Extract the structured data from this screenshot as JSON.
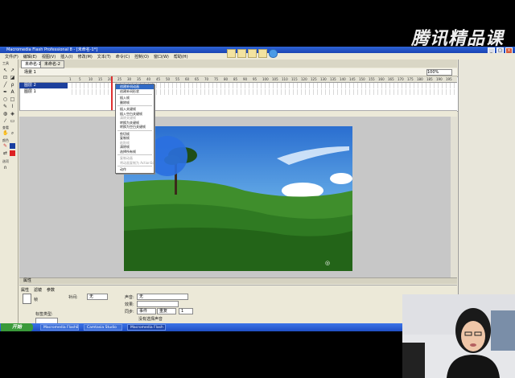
{
  "brand": {
    "logo_text": "腾讯精品课"
  },
  "window": {
    "title": "Macromedia Flash Professional 8 - [未命名-1*]"
  },
  "menu": [
    "文件(F)",
    "编辑(E)",
    "视图(V)",
    "插入(I)",
    "修改(M)",
    "文本(T)",
    "命令(C)",
    "控制(O)",
    "窗口(W)",
    "帮助(H)"
  ],
  "document": {
    "tabs": [
      "未命名-1*",
      "未命名-2"
    ],
    "scene": "场景 1",
    "zoom": "100%"
  },
  "timeline": {
    "frame_numbers": [
      "1",
      "5",
      "10",
      "15",
      "20",
      "25",
      "30",
      "35",
      "40",
      "45",
      "50",
      "55",
      "60",
      "65",
      "70",
      "75",
      "80",
      "85",
      "90",
      "95",
      "100",
      "105",
      "110",
      "115",
      "120",
      "125",
      "130",
      "135",
      "140",
      "145",
      "150",
      "155",
      "160",
      "165",
      "170",
      "175",
      "180",
      "185",
      "190",
      "195"
    ],
    "layers": [
      {
        "name": "图层 2"
      },
      {
        "name": "图层 1"
      }
    ]
  },
  "toolbox": {
    "tools_label": "工具",
    "view_label": "查看",
    "colors_label": "颜色",
    "options_label": "选项"
  },
  "context_menu": {
    "items": [
      {
        "label": "创建补间动画",
        "state": "highlight"
      },
      {
        "label": "创建补间形状",
        "state": "normal"
      },
      {
        "label": "插入帧",
        "state": "normal"
      },
      {
        "label": "删除帧",
        "state": "normal"
      },
      {
        "label": "插入关键帧",
        "state": "normal"
      },
      {
        "label": "插入空白关键帧",
        "state": "normal"
      },
      {
        "label": "清除关键帧",
        "state": "disabled"
      },
      {
        "label": "转换为关键帧",
        "state": "normal"
      },
      {
        "label": "转换为空白关键帧",
        "state": "normal"
      },
      {
        "label": "剪切帧",
        "state": "normal"
      },
      {
        "label": "复制帧",
        "state": "normal"
      },
      {
        "label": "粘贴帧",
        "state": "disabled"
      },
      {
        "label": "清除帧",
        "state": "normal"
      },
      {
        "label": "选择所有帧",
        "state": "normal"
      },
      {
        "label": "复制动画",
        "state": "disabled"
      },
      {
        "label": "将动画复制为 ActionScript 3.0",
        "state": "disabled"
      },
      {
        "label": "动作",
        "state": "normal"
      }
    ]
  },
  "properties": {
    "header": "属性",
    "tabs": [
      "属性",
      "滤镜",
      "参数"
    ],
    "frame_label": "帧",
    "tween_label": "补间:",
    "tween_value": "无",
    "sound_label": "声音:",
    "sound_value": "无",
    "effect_label": "效果:",
    "sync_label": "同步:",
    "sync_value": "事件",
    "repeat_value": "重复",
    "repeat_count": "1",
    "label_type_label": "标签类型:",
    "no_sound": "没有选择声音"
  },
  "taskbar": {
    "start": "开始",
    "items": [
      "Macromedia Flash8",
      "Camtasia Studio",
      "Macromedia Flash"
    ]
  },
  "colors": {
    "titlebar": "#1f4fc4",
    "highlight": "#316ac5",
    "sky": "#3b7fc9",
    "playhead": "#e03030"
  }
}
